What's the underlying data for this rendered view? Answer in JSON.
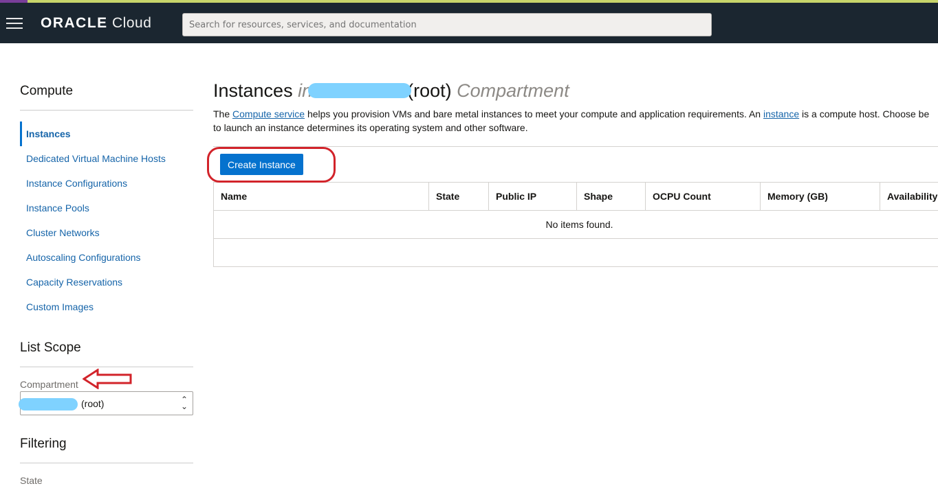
{
  "header": {
    "logo_brand": "ORACLE",
    "logo_product": "Cloud",
    "search_placeholder": "Search for resources, services, and documentation"
  },
  "sidebar": {
    "section_title": "Compute",
    "items": [
      {
        "label": "Instances",
        "active": true
      },
      {
        "label": "Dedicated Virtual Machine Hosts"
      },
      {
        "label": "Instance Configurations"
      },
      {
        "label": "Instance Pools"
      },
      {
        "label": "Cluster Networks"
      },
      {
        "label": "Autoscaling Configurations"
      },
      {
        "label": "Capacity Reservations"
      },
      {
        "label": "Custom Images"
      }
    ],
    "list_scope_title": "List Scope",
    "compartment_label": "Compartment",
    "compartment_value": "(root)",
    "filtering_title": "Filtering",
    "state_label": "State"
  },
  "main": {
    "title_prefix": "Instances",
    "title_in": "in",
    "title_root": "(root)",
    "title_suffix": "Compartment",
    "desc_1": "The ",
    "desc_link1": "Compute service",
    "desc_2": " helps you provision VMs and bare metal instances to meet your compute and application requirements. An ",
    "desc_link2": "instance",
    "desc_3": " is a compute host. Choose be",
    "desc_line2": "to launch an instance determines its operating system and other software.",
    "create_button": "Create Instance",
    "columns": [
      "Name",
      "State",
      "Public IP",
      "Shape",
      "OCPU Count",
      "Memory (GB)",
      "Availability"
    ],
    "empty_message": "No items found."
  },
  "colors": {
    "topbar": "#1b2630",
    "accent": "#0572ce",
    "link": "#1564a9",
    "annotation": "#d2232a"
  }
}
